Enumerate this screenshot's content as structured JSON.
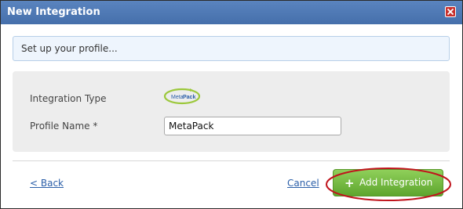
{
  "dialog": {
    "title": "New Integration",
    "info_message": "Set up your profile...",
    "accent_color": "#456fab"
  },
  "form": {
    "integration_type_label": "Integration Type",
    "integration_logo": {
      "icon": "metapack-logo",
      "text_meta": "Meta",
      "text_pack": "Pack"
    },
    "profile_name_label": "Profile Name *",
    "profile_name_value": "MetaPack"
  },
  "footer": {
    "back_label": "< Back",
    "cancel_label": "Cancel",
    "add_icon": "plus-icon",
    "add_label": "Add Integration",
    "add_color": "#6cb33a",
    "highlight_color": "#c0141c"
  }
}
